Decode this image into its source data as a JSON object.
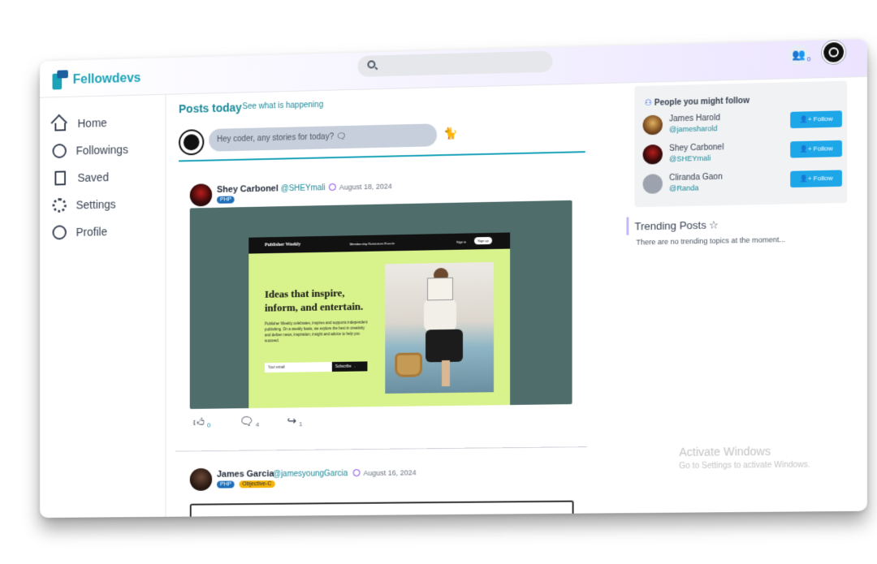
{
  "header": {
    "brand": "Fellowdevs",
    "search_placeholder": "",
    "notifications_count": "0"
  },
  "sidebar": {
    "items": [
      {
        "label": "Home",
        "icon": "home-icon"
      },
      {
        "label": "Followings",
        "icon": "compass-icon"
      },
      {
        "label": "Saved",
        "icon": "bookmark-icon"
      },
      {
        "label": "Settings",
        "icon": "gear-icon"
      },
      {
        "label": "Profile",
        "icon": "profile-icon"
      }
    ]
  },
  "feed": {
    "title": "Posts today",
    "subtitle": "See what is happening",
    "composer_placeholder": "Hey coder, any stories for today? 🗨"
  },
  "posts": [
    {
      "author": "Shey Carbonel",
      "handle": "@SHEYmali",
      "date": "August 18, 2024",
      "tags": [
        "PHP"
      ],
      "likes": "0",
      "comments": "4",
      "shares": "1",
      "image": {
        "brand": "Publisher Weekly",
        "nav": "Membership     Resources     Events",
        "sign_in": "Sign in",
        "join": "Sign up",
        "headline": "Ideas that inspire, inform, and entertain.",
        "body": "Publisher Weekly celebrates, inspires and supports independent publishing. On a weekly basis, we explore the best in creativity and deliver news, inspiration, insight and advice to help you succeed.",
        "email_placeholder": "Your email",
        "subscribe": "Subscribe →"
      }
    },
    {
      "author": "James Garcia",
      "handle": "@jamesyoungGarcia",
      "date": "August 16, 2024",
      "tags": [
        "PHP",
        "Objective-C"
      ]
    }
  ],
  "follow": {
    "title": "People you might follow",
    "button_label": "Follow",
    "people": [
      {
        "name": "James Harold",
        "handle": "@jamesharold"
      },
      {
        "name": "Shey Carbonel",
        "handle": "@SHEYmali"
      },
      {
        "name": "Cliranda Gaon",
        "handle": "@Randa"
      }
    ]
  },
  "trending": {
    "title": "Trending Posts",
    "empty": "There are no trending topics at the moment..."
  },
  "watermark": {
    "line1": "Activate Windows",
    "line2": "Go to Settings to activate Windows."
  },
  "colors": {
    "accent": "#1aa3b8",
    "follow_button": "#1ea7e8",
    "php_tag": "#1e6fb8",
    "objc_tag": "#f5b40a"
  }
}
